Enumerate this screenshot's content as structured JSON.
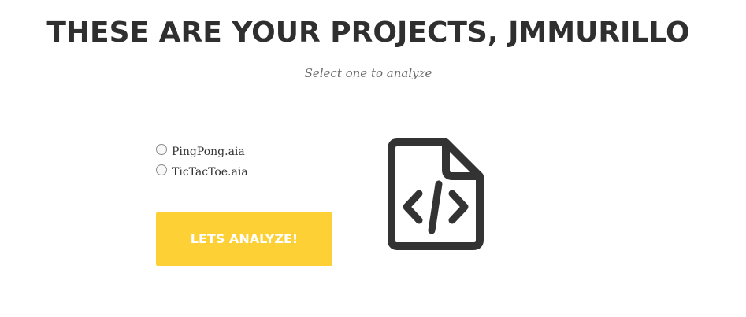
{
  "header": {
    "title": "THESE ARE YOUR PROJECTS, JMMURILLO",
    "subtitle": "Select one to analyze"
  },
  "projects": [
    {
      "label": "PingPong.aia",
      "selected": false
    },
    {
      "label": "TicTacToe.aia",
      "selected": false
    }
  ],
  "actions": {
    "analyze_label": "LETS ANALYZE!"
  },
  "icons": {
    "illustration": "file-code-icon"
  },
  "colors": {
    "accent": "#fdd035",
    "text": "#333333",
    "muted": "#6b6b6b"
  }
}
